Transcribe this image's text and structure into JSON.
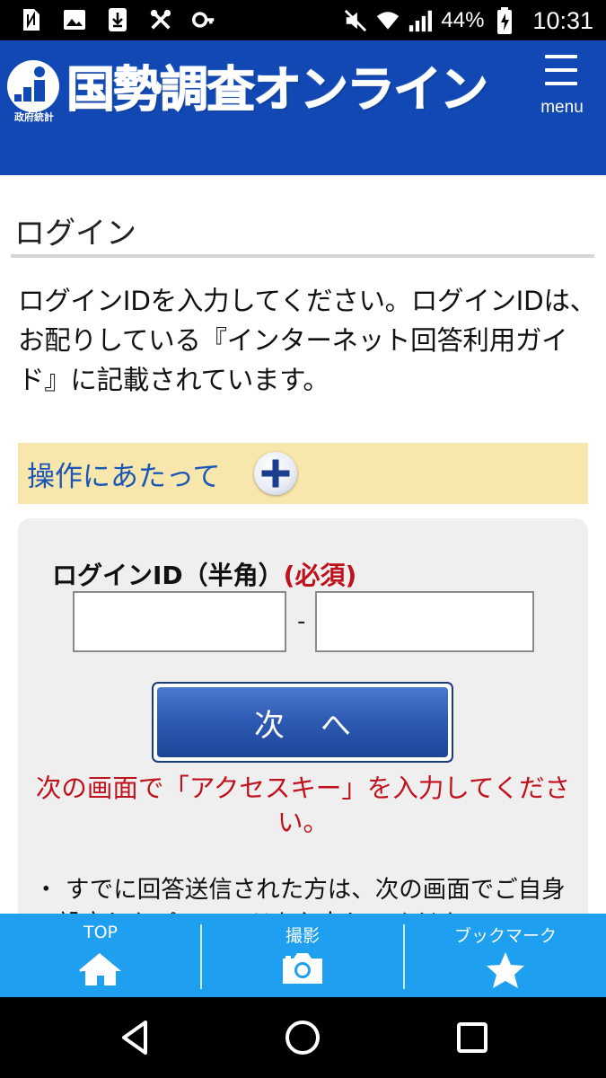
{
  "status_bar": {
    "battery": "44%",
    "time": "10:31"
  },
  "header": {
    "logo_subtitle": "政府統計",
    "site_title": "国勢調査オンライン",
    "menu_label": "menu"
  },
  "page": {
    "heading": "ログイン",
    "intro": "ログインIDを入力してください。ログインIDは、お配りしている『インターネット回答利用ガイド』に記載されています。",
    "accordion_label": "操作にあたって",
    "login_label": "ログインID（半角）",
    "required_label": "(必須)",
    "id_separator": "-",
    "id_part1_value": "",
    "id_part2_value": "",
    "next_button": "次へ",
    "notice": "次の画面で「アクセスキー」を入力してください。",
    "bullet_text": "・ すでに回答送信された方は、次の画面でご自身で設定したパスワードを入力してください。"
  },
  "bottom_nav": {
    "items": [
      {
        "label": "TOP",
        "icon": "home-icon"
      },
      {
        "label": "撮影",
        "icon": "camera-icon"
      },
      {
        "label": "ブックマーク",
        "icon": "star-icon"
      }
    ]
  },
  "colors": {
    "header_blue": "#1148b3",
    "accent_red": "#c0121c",
    "nav_blue": "#1e9ff0",
    "accordion_bg": "#f8e7ac"
  }
}
